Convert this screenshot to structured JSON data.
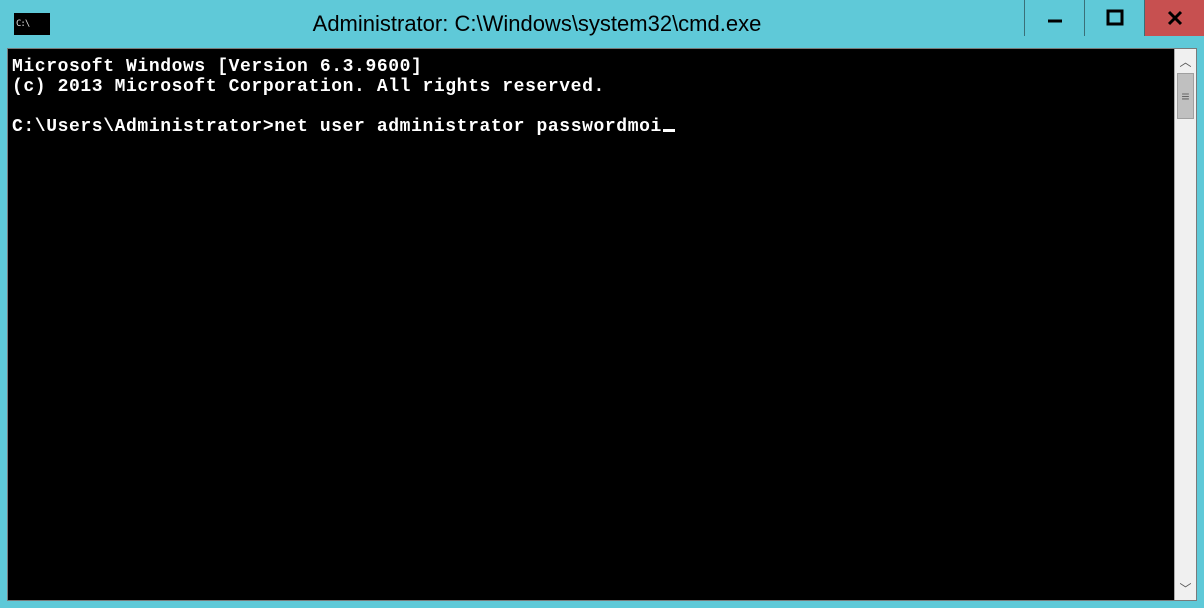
{
  "titlebar": {
    "title": "Administrator: C:\\Windows\\system32\\cmd.exe"
  },
  "window_controls": {
    "minimize": "—",
    "maximize": "◻",
    "close": "✕"
  },
  "terminal": {
    "line1": "Microsoft Windows [Version 6.3.9600]",
    "line2": "(c) 2013 Microsoft Corporation. All rights reserved.",
    "prompt": "C:\\Users\\Administrator>",
    "command": "net user administrator passwordmoi"
  },
  "scrollbar": {
    "up": "︿",
    "down": "﹀",
    "grip": "≡"
  }
}
